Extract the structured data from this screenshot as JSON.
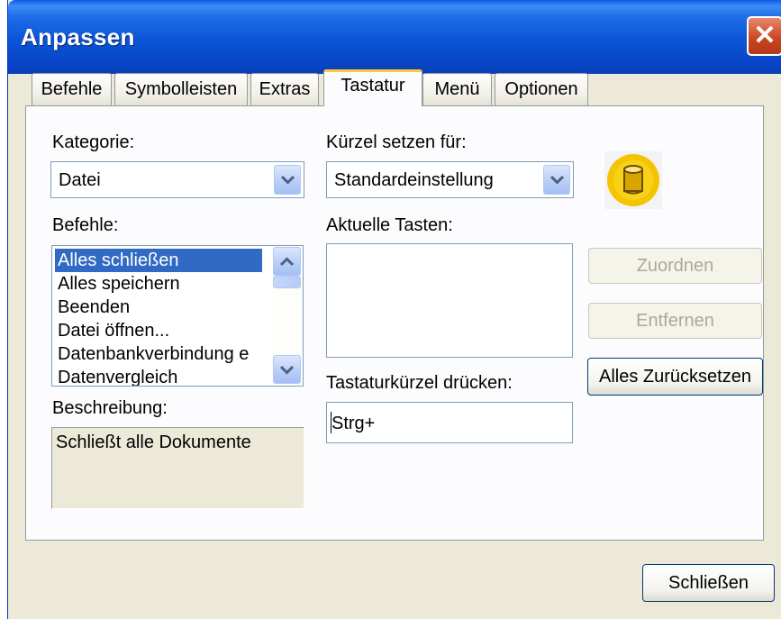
{
  "window": {
    "title": "Anpassen",
    "close_glyph": "✕"
  },
  "tabs": [
    {
      "label": "Befehle",
      "active": false
    },
    {
      "label": "Symbolleisten",
      "active": false
    },
    {
      "label": "Extras",
      "active": false
    },
    {
      "label": "Tastatur",
      "active": true
    },
    {
      "label": "Menü",
      "active": false
    },
    {
      "label": "Optionen",
      "active": false
    }
  ],
  "kategorie": {
    "label": "Kategorie:",
    "value": "Datei"
  },
  "kuerzel": {
    "label": "Kürzel setzen für:",
    "value": "Standardeinstellung"
  },
  "icon": {
    "name": "database-icon",
    "color": "#f5c400"
  },
  "befehle": {
    "label": "Befehle:",
    "items": [
      {
        "label": "Alles schließen",
        "selected": true
      },
      {
        "label": "Alles speichern",
        "selected": false
      },
      {
        "label": "Beenden",
        "selected": false
      },
      {
        "label": "Datei öffnen...",
        "selected": false
      },
      {
        "label": "Datenbankverbindung e",
        "selected": false
      },
      {
        "label": "Datenvergleich",
        "selected": false
      }
    ]
  },
  "aktuelle_tasten": {
    "label": "Aktuelle Tasten:"
  },
  "tastaturkuerzel": {
    "label": "Tastaturkürzel drücken:",
    "value": "Strg+"
  },
  "beschreibung": {
    "label": "Beschreibung:",
    "text": "Schließt alle Dokumente"
  },
  "buttons": {
    "zuordnen": "Zuordnen",
    "entfernen": "Entfernen",
    "alles_zuruecksetzen": "Alles Zurücksetzen",
    "schliessen": "Schließen"
  },
  "colors": {
    "title_bar": "#0a55d6",
    "selection": "#316ac5",
    "active_tab_accent": "#ffc83c",
    "dialog_bg": "#ece9d8"
  }
}
